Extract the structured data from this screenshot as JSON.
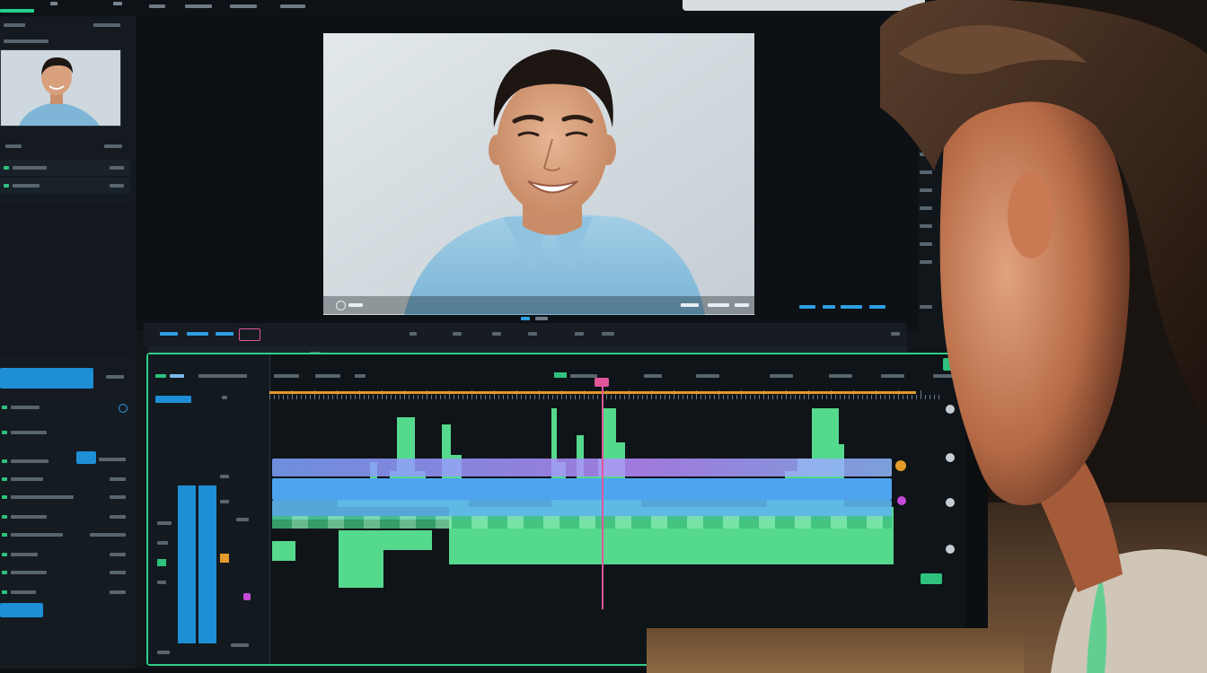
{
  "menu": {
    "items": [
      "",
      "",
      "",
      "",
      "",
      "",
      ""
    ]
  },
  "left_panel": {
    "apply_label": ""
  },
  "preview": {
    "description_hidden": ""
  },
  "colors": {
    "accent_green": "#2fcf88",
    "accent_blue": "#1e8fd6",
    "playhead_pink": "#e0569b",
    "marker_orange": "#e39b2a",
    "waveform_green": "#55d98d"
  }
}
